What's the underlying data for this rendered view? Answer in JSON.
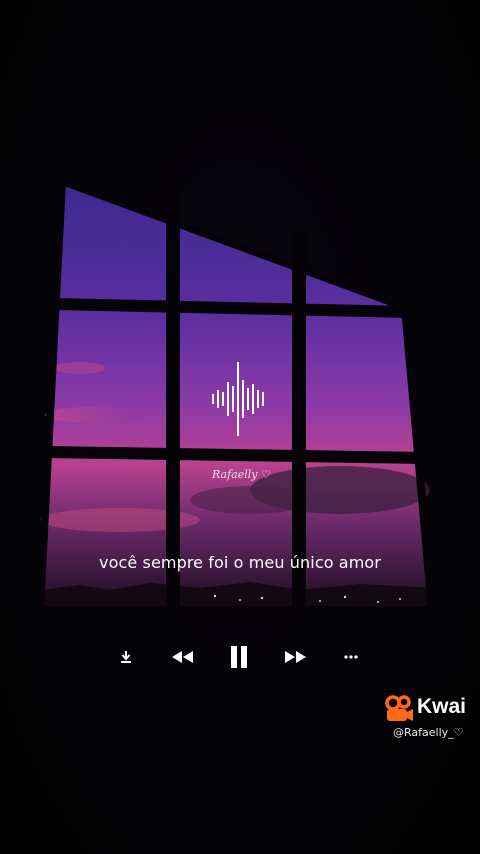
{
  "video": {
    "lyric": "você sempre foi o meu único amor",
    "signature": "Rafaelly ♡"
  },
  "player": {
    "controls": [
      {
        "name": "download-icon"
      },
      {
        "name": "rewind-icon"
      },
      {
        "name": "pause-icon"
      },
      {
        "name": "fast-forward-icon"
      },
      {
        "name": "more-options-icon"
      }
    ]
  },
  "watermark": {
    "brand": "Kwai",
    "handle": "@Rafaelly_♡",
    "logo_color": "#ff6a1a"
  },
  "colors": {
    "sky_top": "#4a2a9a",
    "sky_mid": "#8a3aa8",
    "sky_pink": "#d04a8a",
    "frame": "#050308"
  }
}
